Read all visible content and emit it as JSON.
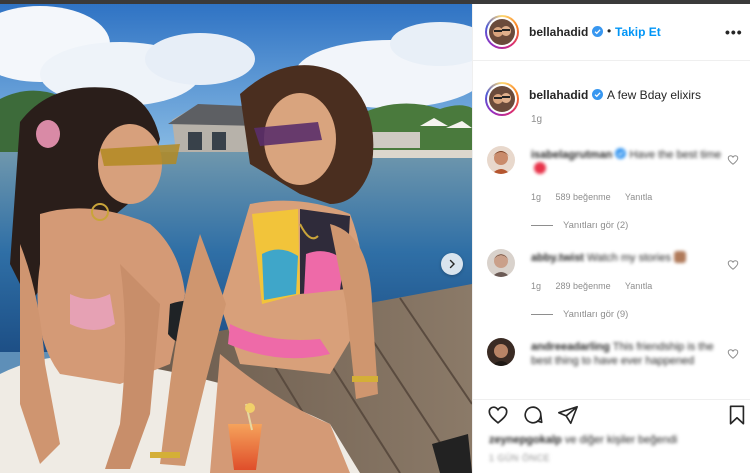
{
  "post": {
    "username": "bellahadid",
    "follow_label": "Takip Et",
    "separator": "•",
    "more_label": "•••",
    "caption": "A few Bday elixirs",
    "caption_time": "1g",
    "liked_by_user": "zeynepgokalp",
    "liked_by_text": "ve diğer kişiler beğendi",
    "date": "1 GÜN ÖNCE"
  },
  "comments": [
    {
      "username": "isabelagrutman",
      "text": "Have the best time",
      "time": "1g",
      "likes": "589 beğenme",
      "reply_label": "Yanıtla",
      "view_replies": "Yanıtları gör (2)",
      "verified": true,
      "emoji_color": "#e8334a"
    },
    {
      "username": "abby.twist",
      "text": "Watch my stories",
      "time": "1g",
      "likes": "289 beğenme",
      "reply_label": "Yanıtla",
      "view_replies": "Yanıtları gör (9)",
      "verified": false,
      "emoji_color": "#b07a5a"
    },
    {
      "username": "andreeadarling",
      "text": "This friendship is the best thing to have ever happened",
      "verified": false
    }
  ],
  "icons": {
    "verified": "verified-badge-icon",
    "next": "chevron-right-icon",
    "like": "heart-icon",
    "comment": "comment-bubble-icon",
    "share": "paper-plane-icon",
    "save": "bookmark-icon",
    "more": "more-dots-icon"
  },
  "colors": {
    "link": "#0095f6",
    "verified": "#3897f0",
    "text": "#262626",
    "muted": "#8e8e8e",
    "border": "#efefef"
  }
}
